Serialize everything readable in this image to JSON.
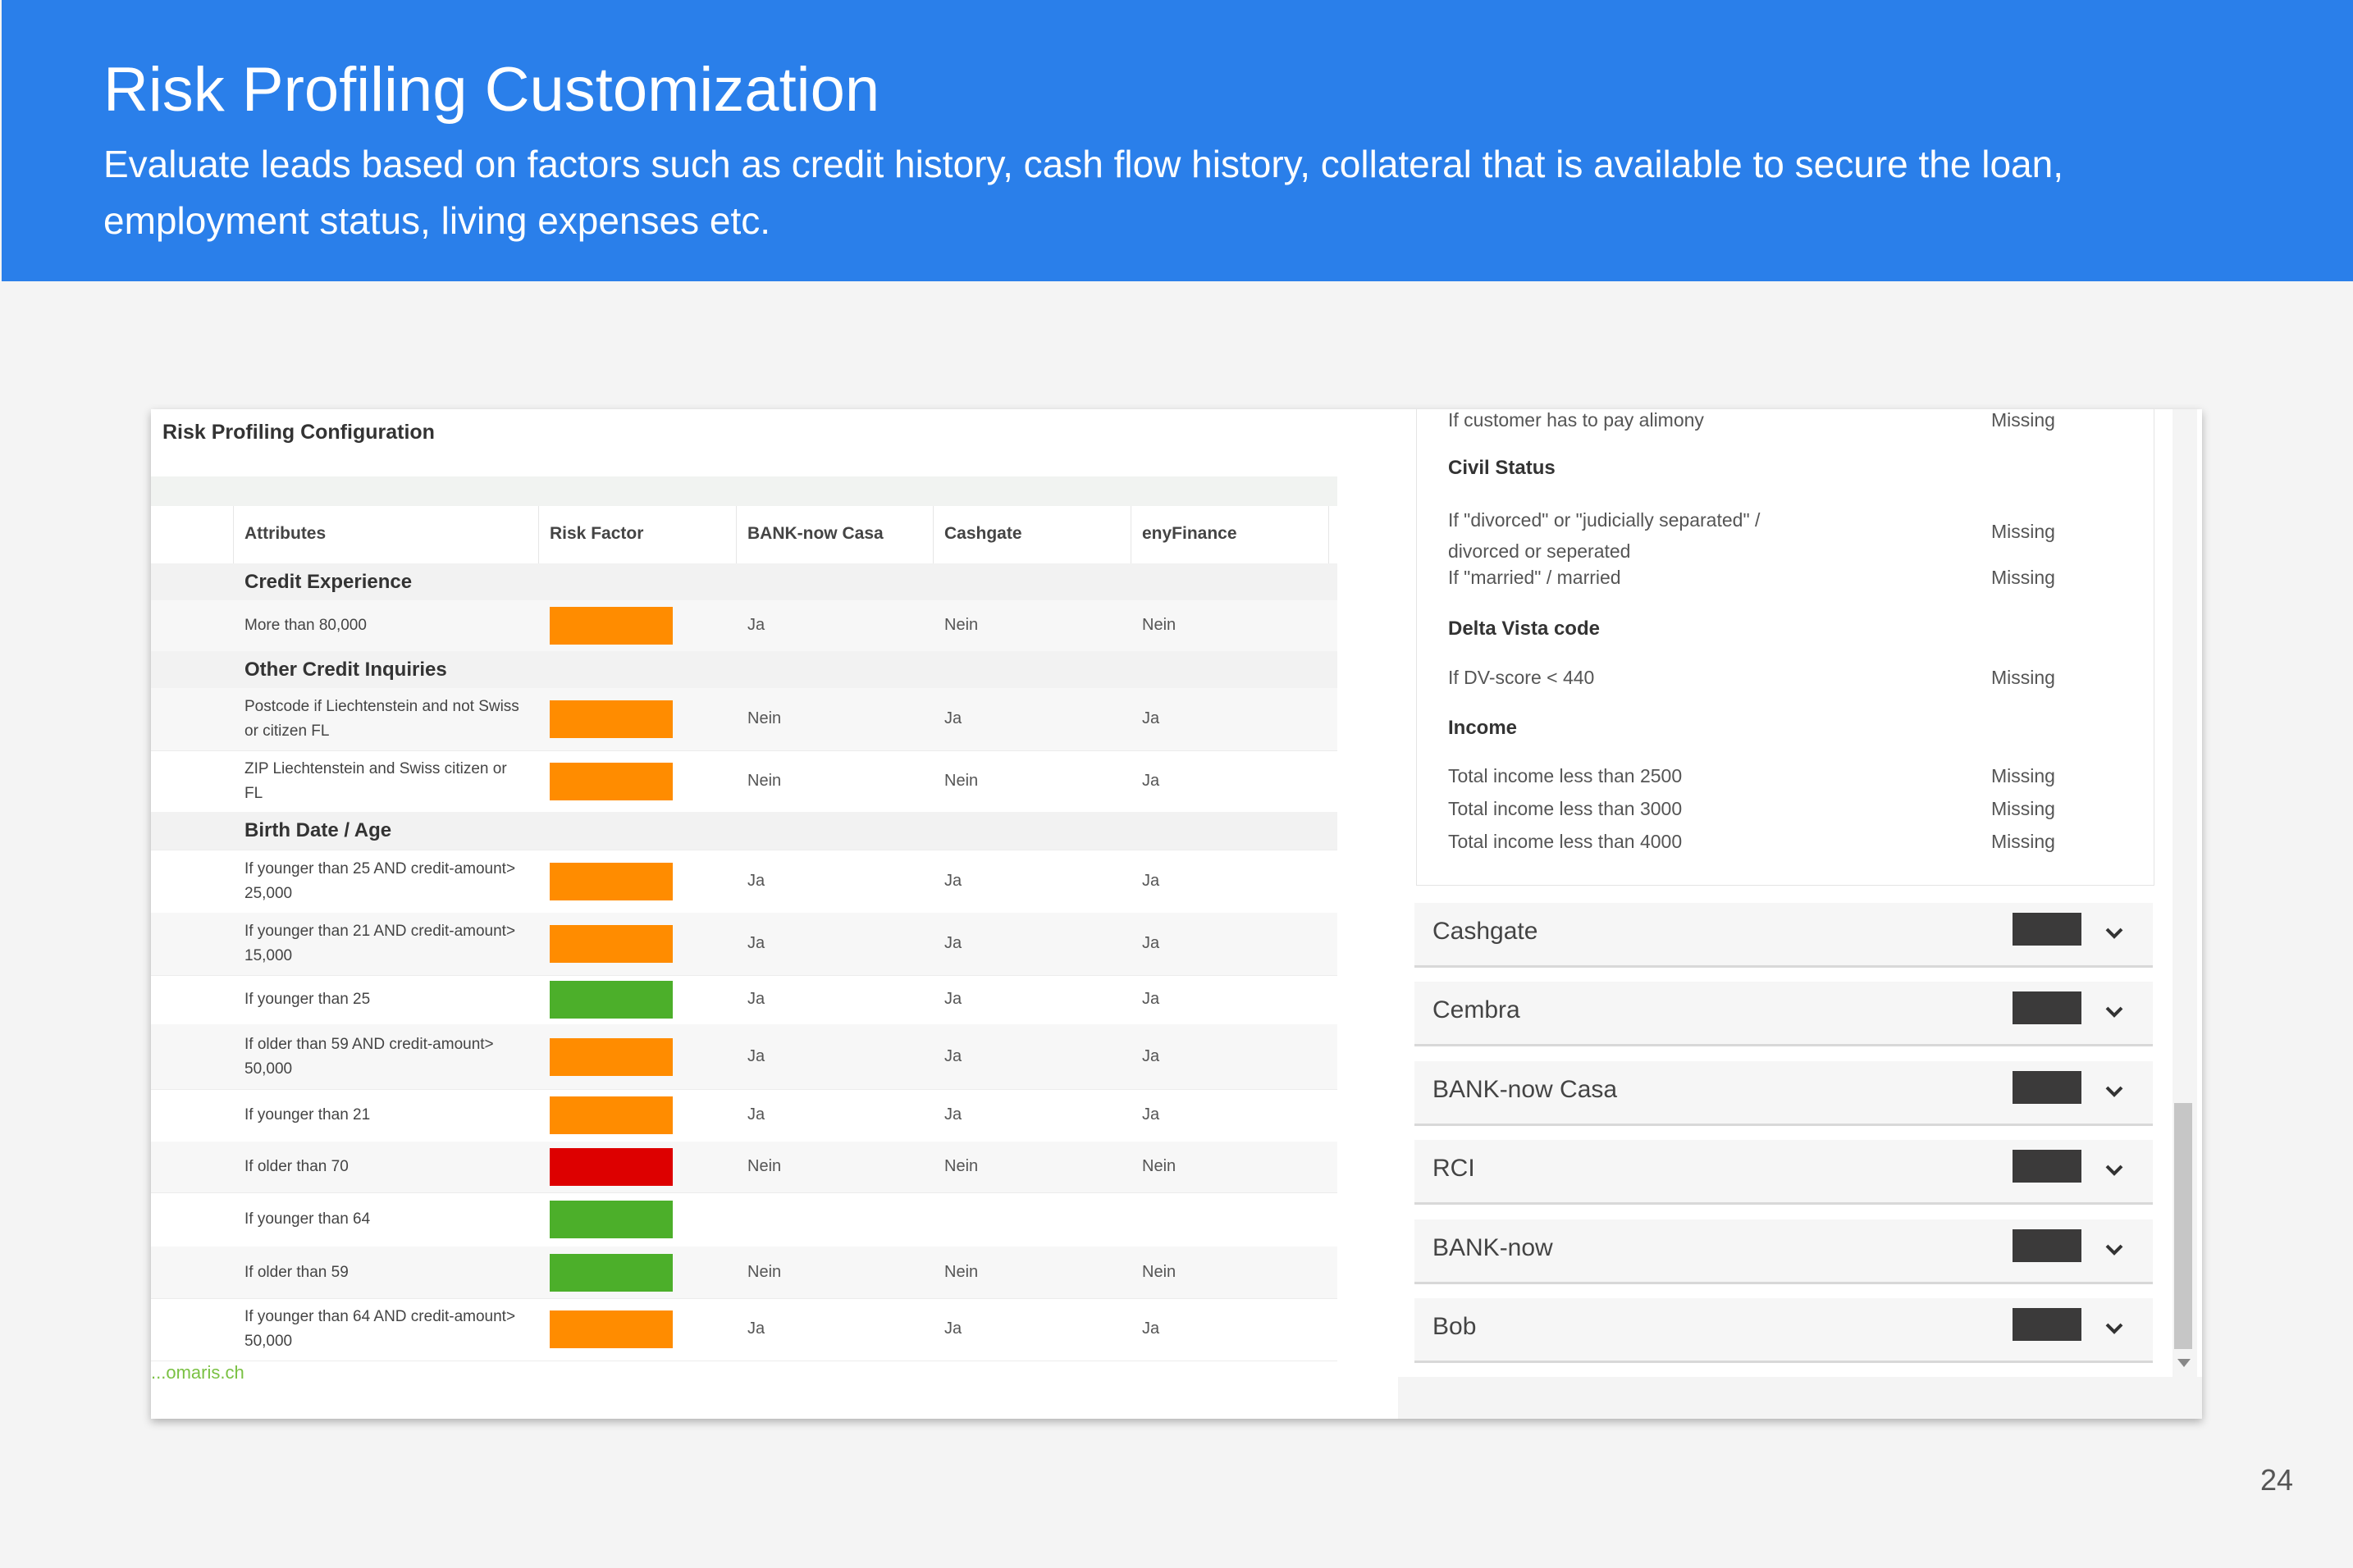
{
  "slide": {
    "title": "Risk Profiling Customization",
    "subtitle": "Evaluate leads based on factors such as credit history, cash flow history, collateral that is available to secure the loan, employment status, living expenses etc.",
    "page_number": "24"
  },
  "colors": {
    "header_bg": "#2a7fea",
    "risk_orange": "#ff8c00",
    "risk_green": "#4caf2a",
    "risk_red": "#dd0000",
    "swatch_dark": "#3b3a3a"
  },
  "config": {
    "title": "Risk Profiling Configuration",
    "columns": [
      "Attributes",
      "Risk Factor",
      "BANK-now Casa",
      "Cashgate",
      "enyFinance"
    ],
    "rows": [
      {
        "type": "section",
        "label": "Credit Experience"
      },
      {
        "type": "data",
        "attribute": "More than 80,000",
        "risk": "orange",
        "v1": "Ja",
        "v2": "Nein",
        "v3": "Nein"
      },
      {
        "type": "section",
        "label": "Other Credit Inquiries"
      },
      {
        "type": "data",
        "attribute": "Postcode if Liechtenstein and not Swiss or citizen FL",
        "risk": "orange",
        "v1": "Nein",
        "v2": "Ja",
        "v3": "Ja"
      },
      {
        "type": "data",
        "attribute": "ZIP Liechtenstein and Swiss citizen or FL",
        "risk": "orange",
        "v1": "Nein",
        "v2": "Nein",
        "v3": "Ja"
      },
      {
        "type": "section",
        "label": "Birth Date / Age"
      },
      {
        "type": "data",
        "attribute": "If younger than 25 AND credit-amount> 25,000",
        "risk": "orange",
        "v1": "Ja",
        "v2": "Ja",
        "v3": "Ja"
      },
      {
        "type": "data",
        "attribute": "If younger than 21 AND credit-amount> 15,000",
        "risk": "orange",
        "v1": "Ja",
        "v2": "Ja",
        "v3": "Ja"
      },
      {
        "type": "data",
        "attribute": "If younger than 25",
        "risk": "green",
        "v1": "Ja",
        "v2": "Ja",
        "v3": "Ja"
      },
      {
        "type": "data",
        "attribute": "If older than 59 AND credit-amount> 50,000",
        "risk": "orange",
        "v1": "Ja",
        "v2": "Ja",
        "v3": "Ja"
      },
      {
        "type": "data",
        "attribute": "If younger than 21",
        "risk": "orange",
        "v1": "Ja",
        "v2": "Ja",
        "v3": "Ja"
      },
      {
        "type": "data",
        "attribute": "If older than 70",
        "risk": "red",
        "v1": "Nein",
        "v2": "Nein",
        "v3": "Nein"
      },
      {
        "type": "data",
        "attribute": "If younger than 64",
        "risk": "green",
        "v1": "",
        "v2": "",
        "v3": ""
      },
      {
        "type": "data",
        "attribute": "If older than 59",
        "risk": "green",
        "v1": "Nein",
        "v2": "Nein",
        "v3": "Nein"
      },
      {
        "type": "data",
        "attribute": "If younger than 64 AND credit-amount> 50,000",
        "risk": "orange",
        "v1": "Ja",
        "v2": "Ja",
        "v3": "Ja"
      }
    ],
    "footer_link": "...omaris.ch"
  },
  "right": {
    "lines": [
      {
        "type": "item",
        "text": "If customer has to pay alimony",
        "status": "Missing"
      },
      {
        "type": "heading",
        "text": "Civil Status"
      },
      {
        "type": "item",
        "text": "If \"divorced\" or \"judicially separated\" / divorced or seperated",
        "status": "Missing"
      },
      {
        "type": "item",
        "text": "If \"married\" / married",
        "status": "Missing"
      },
      {
        "type": "heading",
        "text": "Delta Vista code"
      },
      {
        "type": "item",
        "text": "If DV-score < 440",
        "status": "Missing"
      },
      {
        "type": "heading",
        "text": "Income"
      },
      {
        "type": "item",
        "text": "Total income less than 2500",
        "status": "Missing"
      },
      {
        "type": "item",
        "text": "Total income less than 3000",
        "status": "Missing"
      },
      {
        "type": "item",
        "text": "Total income less than 4000",
        "status": "Missing"
      }
    ],
    "accordions": [
      {
        "label": "Cashgate"
      },
      {
        "label": "Cembra"
      },
      {
        "label": "BANK-now Casa"
      },
      {
        "label": "RCI"
      },
      {
        "label": "BANK-now"
      },
      {
        "label": "Bob"
      }
    ]
  }
}
